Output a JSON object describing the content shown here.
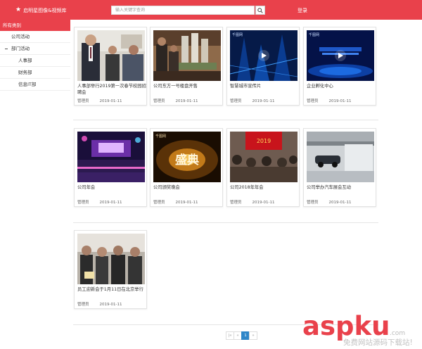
{
  "header": {
    "site_title": "启明星图像&视频库",
    "search_placeholder": "输入关键字查询",
    "login_label": "登录"
  },
  "sidebar": {
    "all_label": "所有类别",
    "items": [
      {
        "label": "公司活动"
      },
      {
        "label": "部门活动"
      },
      {
        "label": "人事部"
      },
      {
        "label": "财务部"
      },
      {
        "label": "信息IT部"
      }
    ]
  },
  "cards": [
    {
      "title": "人事部举行2019第一次春节校园招聘会",
      "author": "管理员",
      "date": "2019-01-11"
    },
    {
      "title": "公司东方一号楼盘开售",
      "author": "管理员",
      "date": "2019-01-11"
    },
    {
      "title": "智慧城市宣传片",
      "author": "管理员",
      "date": "2019-01-11"
    },
    {
      "title": "企业孵化中心",
      "author": "管理员",
      "date": "2019-01-11"
    },
    {
      "title": "公司年会",
      "author": "管理员",
      "date": "2019-01-11"
    },
    {
      "title": "公司颁奖晚会",
      "author": "管理员",
      "date": "2019-01-11"
    },
    {
      "title": "公司2018年年会",
      "author": "管理员",
      "date": "2019-01-11"
    },
    {
      "title": "公司举办汽车展会互动",
      "author": "管理员",
      "date": "2019-01-11"
    },
    {
      "title": "员工迎新会于1月11日在北京举行",
      "author": "管理员",
      "date": "2019-01-11"
    }
  ],
  "thumb_text": {
    "brand_mark": "千图网",
    "gala_text": "盛典",
    "banner_text": "2019"
  },
  "pagination": {
    "first": "|«",
    "prev": "«",
    "current": "1",
    "next": "»"
  },
  "watermark": {
    "logo": "aspku",
    "logo_suffix": ".com",
    "tagline": "免费网站源码下载站!"
  },
  "colors": {
    "brand_red": "#e9414b",
    "pager_active": "#2f86c8"
  },
  "icons": {
    "brand": "star-icon",
    "search": "search-icon",
    "tree_toggle": "minus-icon",
    "video": "play-icon"
  }
}
